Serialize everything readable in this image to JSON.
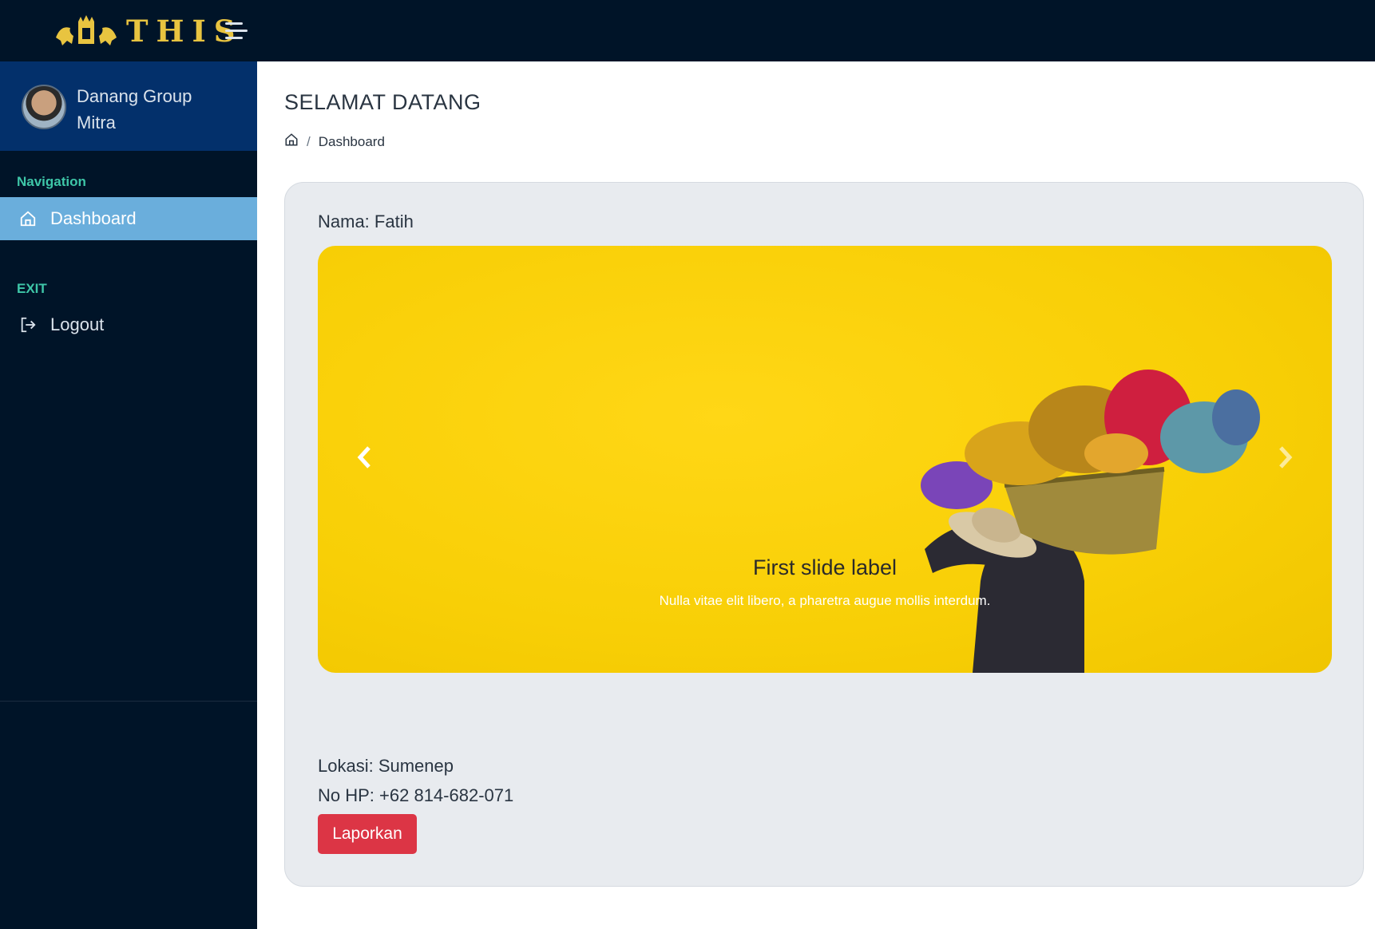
{
  "brand": {
    "name": "THIS"
  },
  "header": {
    "menu_icon": "hamburger-icon"
  },
  "profile": {
    "name": "Danang Group",
    "role": "Mitra"
  },
  "sidebar": {
    "sections": [
      {
        "label": "Navigation",
        "items": [
          {
            "label": "Dashboard",
            "icon": "home-icon",
            "active": true
          }
        ]
      },
      {
        "label": "EXIT",
        "items": [
          {
            "label": "Logout",
            "icon": "logout-icon",
            "active": false
          }
        ]
      }
    ]
  },
  "main": {
    "title": "SELAMAT DATANG",
    "breadcrumb": {
      "home_icon": "home-icon",
      "separator": "/",
      "current": "Dashboard"
    }
  },
  "card": {
    "name_line": "Nama: Fatih",
    "location_line": "Lokasi: Sumenep",
    "phone_line": "No HP: +62 814-682-071",
    "report_button": "Laporkan"
  },
  "carousel": {
    "caption_title": "First slide label",
    "caption_text": "Nulla vitae elit libero, a pharetra augue mollis interdum.",
    "prev_icon": "chevron-left-icon",
    "next_icon": "chevron-right-icon"
  },
  "colors": {
    "topbar": "#001428",
    "profile_bg": "#03306b",
    "active_nav": "#6aaedc",
    "section_label": "#3ec6a8",
    "danger": "#dc3545",
    "slide_bg": "#f8cf06"
  }
}
